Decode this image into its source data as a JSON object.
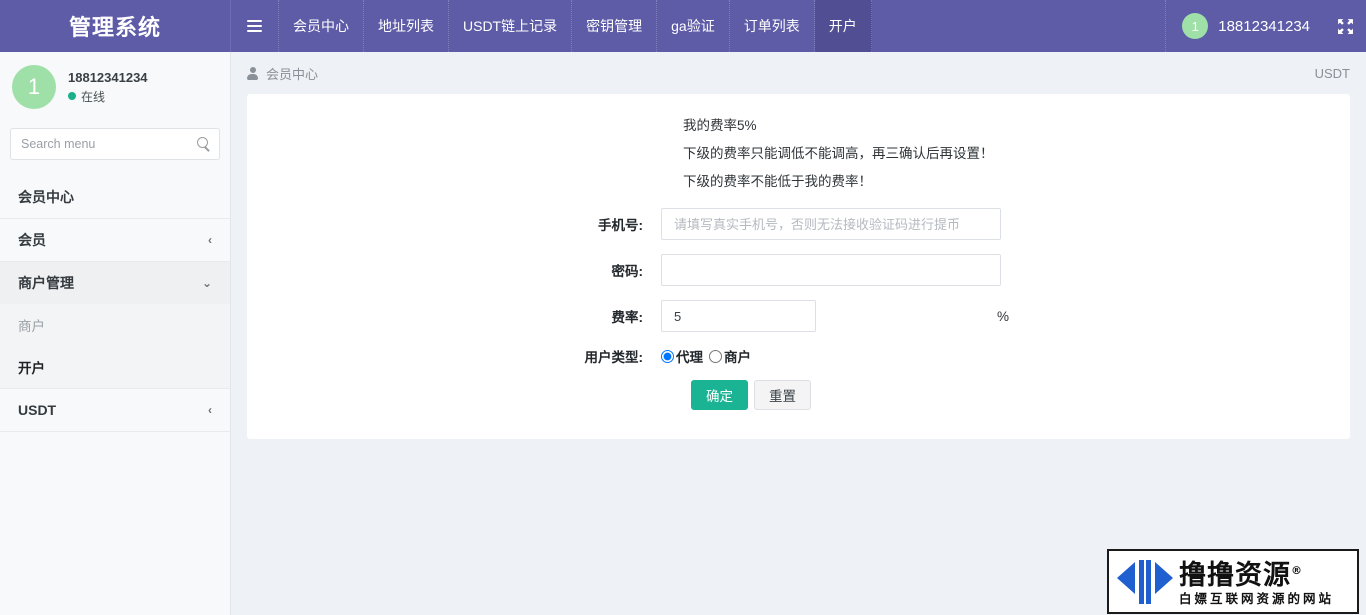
{
  "topbar": {
    "brand": "管理系统",
    "menu_icon": "hamburger-icon",
    "nav_items": [
      {
        "label": "会员中心",
        "active": false
      },
      {
        "label": "地址列表",
        "active": false
      },
      {
        "label": "USDT链上记录",
        "active": false
      },
      {
        "label": "密钥管理",
        "active": false
      },
      {
        "label": "ga验证",
        "active": false
      },
      {
        "label": "订单列表",
        "active": false
      },
      {
        "label": "开户",
        "active": true
      }
    ],
    "avatar_text": "1",
    "username": "18812341234",
    "expand_icon": "⛶",
    "bg_color": "#5e5ba7",
    "active_bg_color": "#514e93"
  },
  "sidebar": {
    "avatar_text": "1",
    "phone": "18812341234",
    "status": "在线",
    "status_color": "#18b189",
    "search_placeholder": "Search menu",
    "search_value": "",
    "items": [
      {
        "label": "会员中心",
        "chevron": ""
      },
      {
        "label": "会员",
        "chevron": "‹"
      },
      {
        "label": "商户管理",
        "chevron": "⌄"
      }
    ],
    "submenu": [
      {
        "label": "商户",
        "active": false
      },
      {
        "label": "开户",
        "active": true
      }
    ],
    "bottom_item": {
      "label": "USDT",
      "chevron": "‹"
    }
  },
  "breadcrumb": {
    "icon": "user-icon",
    "label": "会员中心",
    "right_label": "USDT"
  },
  "main": {
    "notices": [
      "我的费率5%",
      "下级的费率只能调低不能调高，再三确认后再设置！",
      "下级的费率不能低于我的费率！"
    ],
    "fields": {
      "phone_label": "手机号:",
      "phone_placeholder": "请填写真实手机号，否则无法接收验证码进行提币",
      "phone_value": "",
      "password_label": "密码:",
      "password_value": "",
      "rate_label": "费率:",
      "rate_value": "5",
      "rate_suffix": "%",
      "usertype_label": "用户类型:",
      "usertype_options": [
        {
          "label": "代理",
          "checked": true
        },
        {
          "label": "商户",
          "checked": false
        }
      ]
    },
    "buttons": {
      "submit": "确定",
      "reset": "重置",
      "submit_color": "#1ab394"
    }
  },
  "watermark": {
    "title": "撸撸资源",
    "registered": "®",
    "subtitle": "白嫖互联网资源的网站",
    "mark_color": "#1f5fd0"
  }
}
